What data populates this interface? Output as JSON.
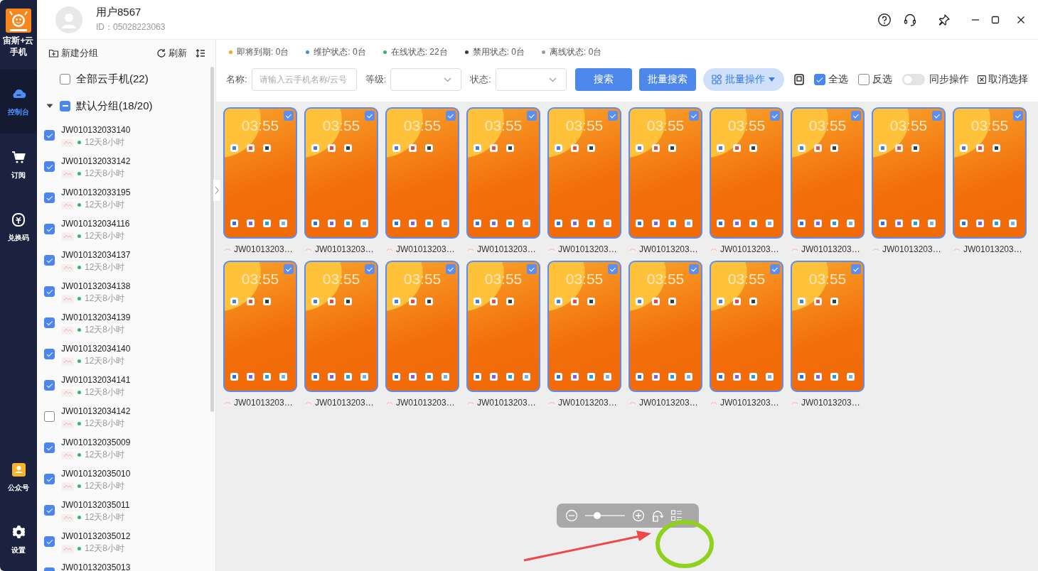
{
  "app": {
    "logo_text": "宙斯+云手机"
  },
  "nav": [
    {
      "label": "控制台",
      "selected": true
    },
    {
      "label": "订阅",
      "selected": false
    },
    {
      "label": "兑换码",
      "selected": false
    },
    {
      "label": "公众号",
      "selected": false
    },
    {
      "label": "设置",
      "selected": false
    }
  ],
  "user": {
    "name": "用户8567",
    "id": "ID：05028223063"
  },
  "groups_panel": {
    "new_group": "新建分组",
    "refresh": "刷新",
    "all": {
      "label": "全部云手机(22)",
      "checked": false
    },
    "group": {
      "label": "默认分组(18/20)",
      "expanded": true,
      "checked": true,
      "indeterminate": true,
      "devices": [
        {
          "name": "JW010132033140",
          "checked": true,
          "remaining": "12天8小时",
          "color": "#3cb371"
        },
        {
          "name": "JW010132033142",
          "checked": true,
          "remaining": "12天8小时",
          "color": "#3cb371"
        },
        {
          "name": "JW010132033195",
          "checked": true,
          "remaining": "12天8小时",
          "color": "#3cb371"
        },
        {
          "name": "JW010132034116",
          "checked": true,
          "remaining": "12天8小时",
          "color": "#3cb371"
        },
        {
          "name": "JW010132034137",
          "checked": true,
          "remaining": "12天8小时",
          "color": "#3cb371"
        },
        {
          "name": "JW010132034138",
          "checked": true,
          "remaining": "12天8小时",
          "color": "#3cb371"
        },
        {
          "name": "JW010132034139",
          "checked": true,
          "remaining": "12天8小时",
          "color": "#3cb371"
        },
        {
          "name": "JW010132034140",
          "checked": true,
          "remaining": "12天8小时",
          "color": "#3cb371"
        },
        {
          "name": "JW010132034141",
          "checked": true,
          "remaining": "12天8小时",
          "color": "#3cb371"
        },
        {
          "name": "JW010132034142",
          "checked": false,
          "remaining": "12天8小时",
          "color": "#3cb371"
        },
        {
          "name": "JW010132035009",
          "checked": true,
          "remaining": "12天8小时",
          "color": "#3cb371"
        },
        {
          "name": "JW010132035010",
          "checked": true,
          "remaining": "12天8小时",
          "color": "#3cb371"
        },
        {
          "name": "JW010132035011",
          "checked": true,
          "remaining": "12天8小时",
          "color": "#3cb371"
        },
        {
          "name": "JW010132035012",
          "checked": true,
          "remaining": "12天8小时",
          "color": "#3cb371"
        },
        {
          "name": "JW010132035013",
          "checked": true
        }
      ]
    }
  },
  "legend": [
    {
      "label": "即将到期: 0台",
      "color": "#f5a623"
    },
    {
      "label": "维护状态: 0台",
      "color": "#3a8ee6"
    },
    {
      "label": "在线状态: 22台",
      "color": "#3cb371"
    },
    {
      "label": "禁用状态: 0台",
      "color": "#34394a"
    },
    {
      "label": "离线状态: 0台",
      "color": "#999999"
    }
  ],
  "filters": {
    "name_label": "名称:",
    "name_placeholder": "请输入云手机名称/云号",
    "level_label": "等级:",
    "status_label": "状态:"
  },
  "buttons": {
    "search": "搜索",
    "batch_search": "批量搜索",
    "batch_ops": "批量操作"
  },
  "select_all": {
    "label": "全选",
    "checked": true
  },
  "invert": {
    "label": "反选",
    "checked": false
  },
  "sync": {
    "label": "同步操作",
    "on": false
  },
  "clear": "取消选择",
  "devices": [
    {
      "label": "JW01013203…",
      "clock": "03:55",
      "selected": true
    },
    {
      "label": "JW01013203…",
      "clock": "03:55",
      "selected": true
    },
    {
      "label": "JW01013203…",
      "clock": "03:55",
      "selected": true
    },
    {
      "label": "JW01013203…",
      "clock": "03:55",
      "selected": true
    },
    {
      "label": "JW01013203…",
      "clock": "03:55",
      "selected": true
    },
    {
      "label": "JW01013203…",
      "clock": "03:55",
      "selected": true
    },
    {
      "label": "JW01013203…",
      "clock": "03:55",
      "selected": true
    },
    {
      "label": "JW01013203…",
      "clock": "03:55",
      "selected": true
    },
    {
      "label": "JW01013203…",
      "clock": "03:55",
      "selected": true
    },
    {
      "label": "JW01013203…",
      "clock": "03:55",
      "selected": true
    },
    {
      "label": "JW01013203…",
      "clock": "03:55",
      "selected": true
    },
    {
      "label": "JW01013203…",
      "clock": "03:55",
      "selected": true
    },
    {
      "label": "JW01013203…",
      "clock": "03:55",
      "selected": true
    },
    {
      "label": "JW01013203…",
      "clock": "03:55",
      "selected": true
    },
    {
      "label": "JW01013203…",
      "clock": "03:55",
      "selected": true
    },
    {
      "label": "JW01013203…",
      "clock": "03:55",
      "selected": true
    },
    {
      "label": "JW01013203…",
      "clock": "03:55",
      "selected": true
    },
    {
      "label": "JW01013203…",
      "clock": "03:55",
      "selected": true
    }
  ],
  "zoom": {
    "level": 0.3
  }
}
